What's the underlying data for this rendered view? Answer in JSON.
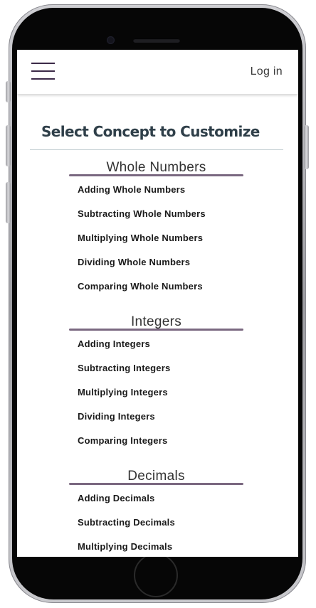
{
  "header": {
    "login_label": "Log in"
  },
  "page": {
    "title": "Select Concept to Customize"
  },
  "sections": [
    {
      "heading": "Whole Numbers",
      "items": [
        "Adding Whole Numbers",
        "Subtracting Whole Numbers",
        "Multiplying Whole Numbers",
        "Dividing Whole Numbers",
        "Comparing Whole Numbers"
      ]
    },
    {
      "heading": "Integers",
      "items": [
        "Adding Integers",
        "Subtracting Integers",
        "Multiplying Integers",
        "Dividing Integers",
        "Comparing Integers"
      ]
    },
    {
      "heading": "Decimals",
      "items": [
        "Adding Decimals",
        "Subtracting Decimals",
        "Multiplying Decimals"
      ]
    }
  ],
  "icons": {
    "menu": "hamburger-menu-icon"
  },
  "colors": {
    "section_bar": "#7a6880",
    "title": "#2f3f49",
    "menu_icon": "#3c2a48"
  }
}
